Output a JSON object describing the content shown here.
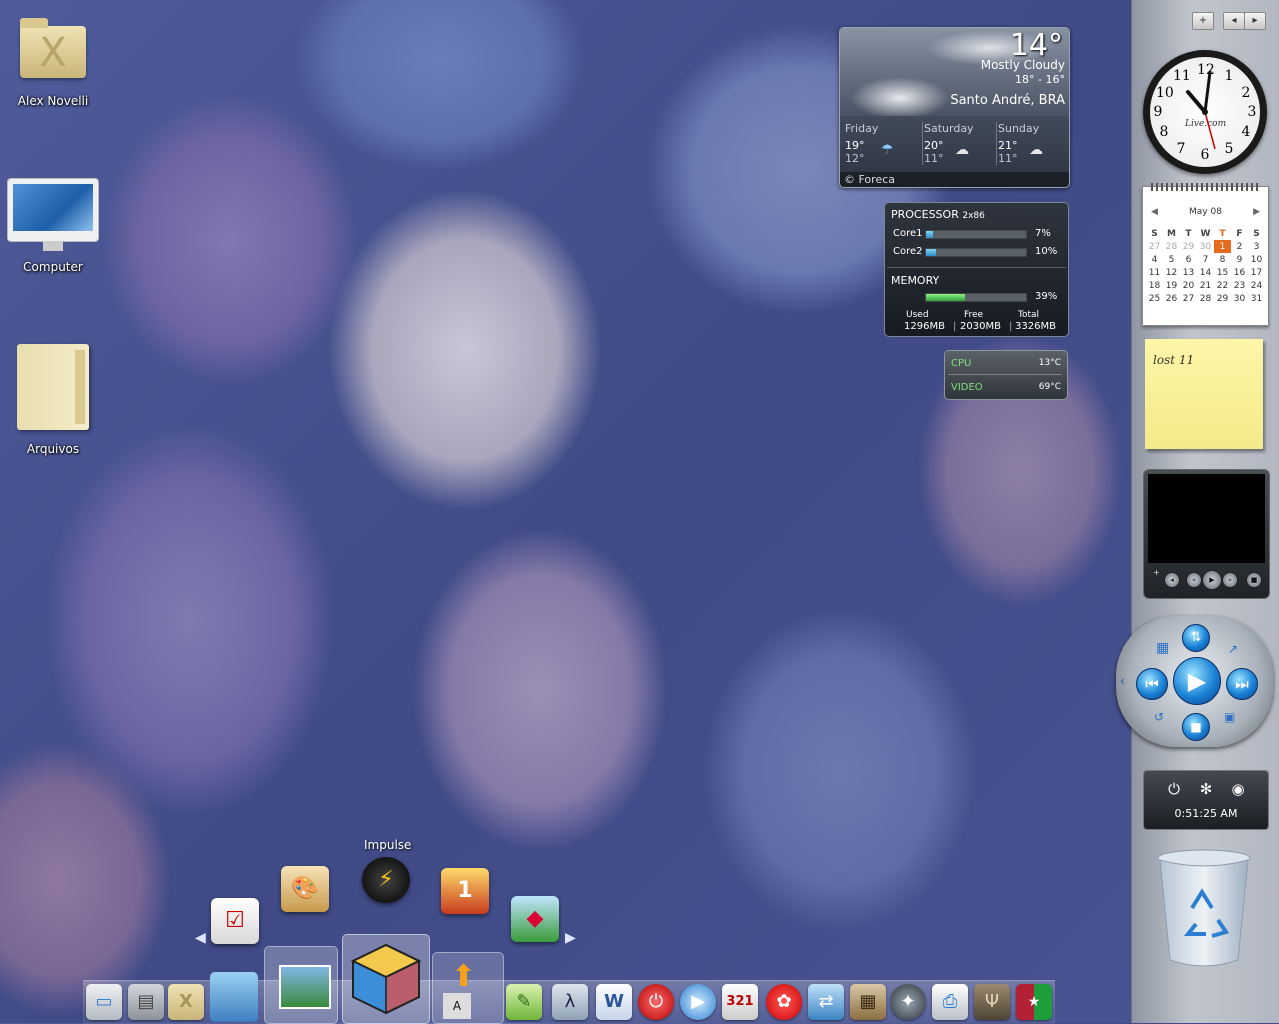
{
  "desktop": {
    "icons": [
      {
        "label": "Alex Novelli",
        "glyph": "X"
      },
      {
        "label": "Computer"
      },
      {
        "label": "Arquivos"
      }
    ]
  },
  "weather": {
    "temp": "14°",
    "condition": "Mostly Cloudy",
    "range": "18° - 16°",
    "city": "Santo André, BRA",
    "forecast": [
      {
        "day": "Friday",
        "hi": "19°",
        "lo": "12°"
      },
      {
        "day": "Saturday",
        "hi": "20°",
        "lo": "11°"
      },
      {
        "day": "Sunday",
        "hi": "21°",
        "lo": "11°"
      }
    ],
    "credit": "© Foreca"
  },
  "processor": {
    "title": "PROCESSOR",
    "arch": "2x86",
    "cores": [
      {
        "label": "Core1",
        "value": "7%",
        "fraction": 0.07
      },
      {
        "label": "Core2",
        "value": "10%",
        "fraction": 0.1
      }
    ],
    "memory": {
      "title": "MEMORY",
      "value": "39%",
      "fraction": 0.39,
      "used_label": "Used",
      "used": "1296MB",
      "free_label": "Free",
      "free": "2030MB",
      "total_label": "Total",
      "total": "3326MB"
    }
  },
  "temps": [
    {
      "label": "CPU",
      "value": "13°C"
    },
    {
      "label": "VIDEO",
      "value": "69°C"
    }
  ],
  "sidebar": {
    "buttons": [
      "+",
      "◂",
      "▸"
    ]
  },
  "clock": {
    "brand": "Live.com",
    "numbers": [
      "12",
      "1",
      "2",
      "3",
      "4",
      "5",
      "6",
      "7",
      "8",
      "9",
      "10",
      "11"
    ]
  },
  "calendar": {
    "month": "May 08",
    "weekdays": [
      "S",
      "M",
      "T",
      "W",
      "T",
      "F",
      "S"
    ],
    "weeks": [
      [
        "27",
        "28",
        "29",
        "30",
        "1",
        "2",
        "3"
      ],
      [
        "4",
        "5",
        "6",
        "7",
        "8",
        "9",
        "10"
      ],
      [
        "11",
        "12",
        "13",
        "14",
        "15",
        "16",
        "17"
      ],
      [
        "18",
        "19",
        "20",
        "21",
        "22",
        "23",
        "24"
      ],
      [
        "25",
        "26",
        "27",
        "28",
        "29",
        "30",
        "31"
      ]
    ]
  },
  "note": {
    "text": "lost 11"
  },
  "shutdown": {
    "time": "0:51:25 AM"
  },
  "dock": {
    "fan_label": "Impulse"
  },
  "colors": {
    "accent": "#e66a1d",
    "cpu_bar": "#2d8fc7",
    "mem_bar": "#2fa13b",
    "temp_text": "#7fe07a"
  }
}
